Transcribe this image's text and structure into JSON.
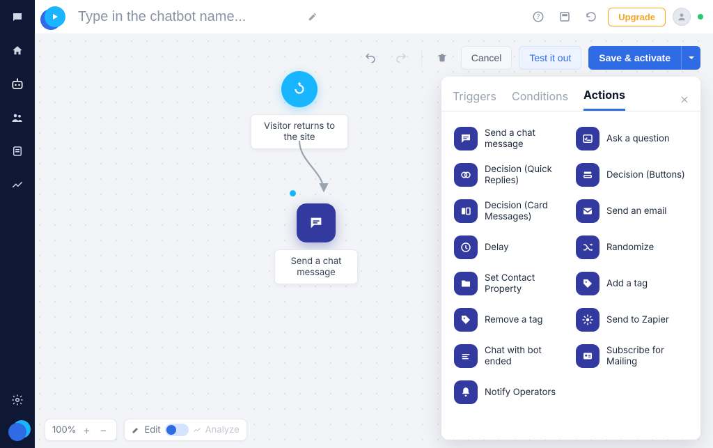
{
  "colors": {
    "accent": "#2e6be5",
    "trigger": "#18b6ff",
    "action": "#323a9f",
    "upgrade": "#f5a623"
  },
  "sidebar": {
    "items": [
      {
        "name": "chat-bubble-icon"
      },
      {
        "name": "home-icon"
      },
      {
        "name": "bot-icon",
        "active": true
      },
      {
        "name": "people-icon"
      },
      {
        "name": "docs-icon"
      },
      {
        "name": "analytics-icon"
      }
    ],
    "gear": "gear-icon",
    "brand": "brand-icon"
  },
  "header": {
    "name_placeholder": "Type in the chatbot name...",
    "name_value": "",
    "upgrade_label": "Upgrade"
  },
  "toolbar": {
    "cancel_label": "Cancel",
    "test_label": "Test it out",
    "save_label": "Save & activate"
  },
  "flow": {
    "trigger_label": "Visitor returns to the site",
    "action_label": "Send a chat message"
  },
  "panel": {
    "tabs": {
      "triggers": "Triggers",
      "conditions": "Conditions",
      "actions": "Actions"
    },
    "active_tab": "actions",
    "actions": [
      {
        "key": "send-chat",
        "label": "Send a chat message",
        "icon": "chat"
      },
      {
        "key": "ask-question",
        "label": "Ask a question",
        "icon": "question"
      },
      {
        "key": "decision-quick",
        "label": "Decision (Quick Replies)",
        "icon": "quick"
      },
      {
        "key": "decision-buttons",
        "label": "Decision (Buttons)",
        "icon": "buttons"
      },
      {
        "key": "decision-cards",
        "label": "Decision (Card Messages)",
        "icon": "cards"
      },
      {
        "key": "send-email",
        "label": "Send an email",
        "icon": "mail"
      },
      {
        "key": "delay",
        "label": "Delay",
        "icon": "clock"
      },
      {
        "key": "randomize",
        "label": "Randomize",
        "icon": "shuffle"
      },
      {
        "key": "set-contact",
        "label": "Set Contact Property",
        "icon": "folder"
      },
      {
        "key": "add-tag",
        "label": "Add a tag",
        "icon": "tag"
      },
      {
        "key": "remove-tag",
        "label": "Remove a tag",
        "icon": "tag-out"
      },
      {
        "key": "zapier",
        "label": "Send to Zapier",
        "icon": "zap"
      },
      {
        "key": "bot-ended",
        "label": "Chat with bot ended",
        "icon": "end"
      },
      {
        "key": "subscribe",
        "label": "Subscribe for Mailing",
        "icon": "idcard"
      },
      {
        "key": "notify",
        "label": "Notify Operators",
        "icon": "bell"
      }
    ]
  },
  "footer": {
    "zoom": "100%",
    "edit_label": "Edit",
    "analyze_label": "Analyze"
  }
}
